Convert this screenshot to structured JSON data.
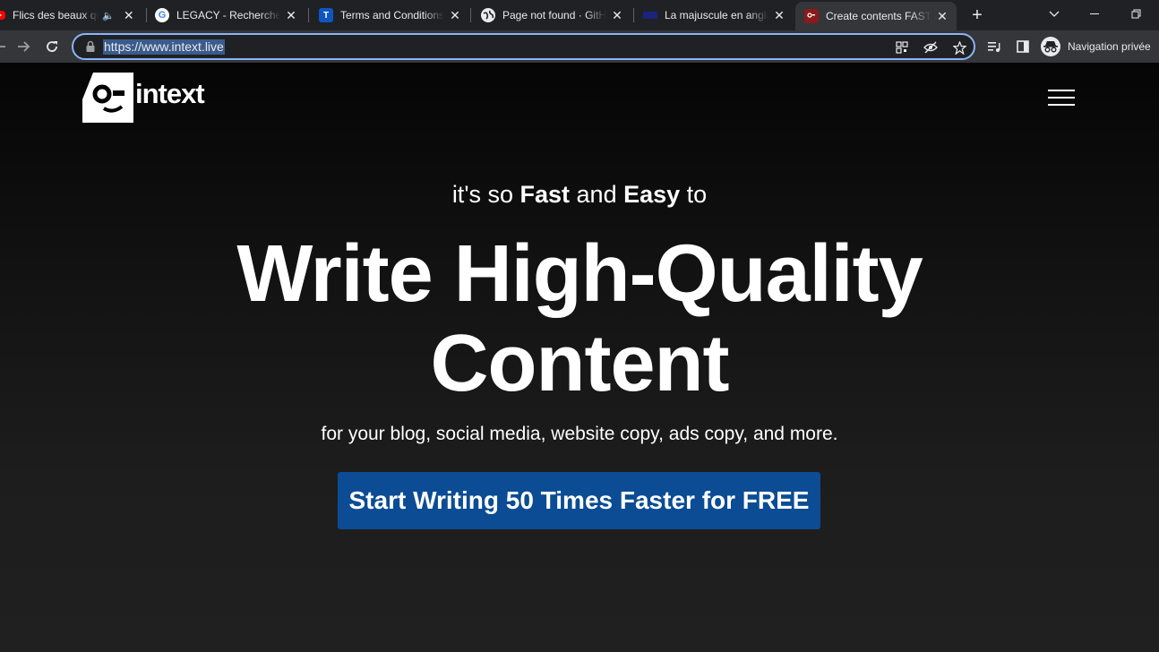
{
  "tabs": [
    {
      "title": "Flics des beaux quartiers",
      "favicon": "youtube-icon",
      "audio": true
    },
    {
      "title": "LEGACY - Recherche Google",
      "favicon": "google-icon"
    },
    {
      "title": "Terms and Conditions",
      "favicon": "t-icon",
      "favicon_text": "T"
    },
    {
      "title": "Page not found · GitHub",
      "favicon": "github-icon"
    },
    {
      "title": "La majuscule en anglais",
      "favicon": "flag-icon"
    },
    {
      "title": "Create contents FASTER",
      "favicon": "intext-icon",
      "active": true
    }
  ],
  "toolbar": {
    "url": "https://www.intext.live",
    "profile_label": "Navigation privée"
  },
  "site": {
    "logo_text": "intext"
  },
  "hero": {
    "tagline_pre": "it's so ",
    "tagline_fast": "Fast",
    "tagline_mid": " and ",
    "tagline_easy": "Easy",
    "tagline_post": " to",
    "headline_line1": "Write High-Quality",
    "headline_line2": "Content",
    "subtitle": "for your blog, social media, website copy, ads copy, and more.",
    "cta_label": "Start Writing 50 Times Faster for FREE"
  },
  "colors": {
    "accent": "#0b4c94",
    "page_bg": "#1f1f1f",
    "omnibox_focus": "#8ab4f8"
  }
}
